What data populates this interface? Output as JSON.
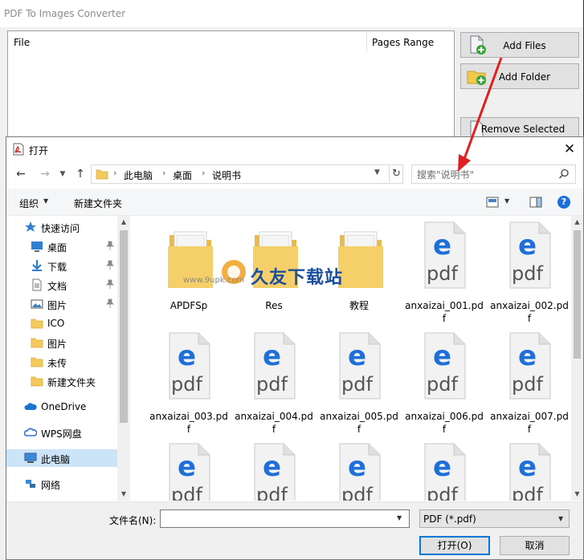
{
  "app": {
    "title": "PDF To Images Converter",
    "columns": {
      "file": "File",
      "pages_range": "Pages Range"
    },
    "buttons": {
      "add_files": "Add Files",
      "add_folder": "Add Folder",
      "remove_selected": "Remove Selected"
    }
  },
  "dialog": {
    "title": "打开",
    "address": {
      "crumbs": [
        "此电脑",
        "桌面",
        "说明书"
      ]
    },
    "search": {
      "placeholder": "搜索\"说明书\""
    },
    "toolbar": {
      "organize": "组织",
      "new_folder": "新建文件夹"
    },
    "nav": [
      {
        "label": "快速访问",
        "icon": "star-icon",
        "pinned": false
      },
      {
        "label": "桌面",
        "icon": "desktop-icon",
        "pinned": true
      },
      {
        "label": "下载",
        "icon": "download-icon",
        "pinned": true
      },
      {
        "label": "文档",
        "icon": "document-icon",
        "pinned": true
      },
      {
        "label": "图片",
        "icon": "picture-icon",
        "pinned": true
      },
      {
        "label": "ICO",
        "icon": "folder-icon",
        "pinned": false
      },
      {
        "label": "图片",
        "icon": "folder-icon",
        "pinned": false
      },
      {
        "label": "未传",
        "icon": "folder-icon",
        "pinned": false
      },
      {
        "label": "新建文件夹",
        "icon": "folder-icon",
        "pinned": false
      },
      {
        "label": "OneDrive",
        "icon": "cloud-icon",
        "pinned": false
      },
      {
        "label": "WPS网盘",
        "icon": "wps-cloud-icon",
        "pinned": false
      },
      {
        "label": "此电脑",
        "icon": "computer-icon",
        "pinned": false,
        "selected": true
      },
      {
        "label": "网络",
        "icon": "network-icon",
        "pinned": false
      }
    ],
    "files": [
      {
        "name": "APDFSp",
        "type": "folder"
      },
      {
        "name": "Res",
        "type": "folder"
      },
      {
        "name": "教程",
        "type": "folder"
      },
      {
        "name": "anxaizai_001.pdf",
        "type": "pdf"
      },
      {
        "name": "anxaizai_002.pdf",
        "type": "pdf"
      },
      {
        "name": "anxaizai_003.pdf",
        "type": "pdf"
      },
      {
        "name": "anxaizai_004.pdf",
        "type": "pdf"
      },
      {
        "name": "anxaizai_005.pdf",
        "type": "pdf"
      },
      {
        "name": "anxaizai_006.pdf",
        "type": "pdf"
      },
      {
        "name": "anxaizai_007.pdf",
        "type": "pdf"
      },
      {
        "name": "",
        "type": "pdf"
      },
      {
        "name": "",
        "type": "pdf"
      },
      {
        "name": "",
        "type": "pdf"
      },
      {
        "name": "",
        "type": "pdf"
      },
      {
        "name": "",
        "type": "pdf"
      }
    ],
    "pdf_icon_text": "pdf",
    "filename": {
      "label": "文件名(N):",
      "value": ""
    },
    "filetype": {
      "value": "PDF (*.pdf)"
    },
    "buttons": {
      "open": "打开(O)",
      "cancel": "取消"
    }
  },
  "watermark": {
    "text": "久友下载站",
    "url": "www.9upk.com"
  },
  "colors": {
    "accent": "#0078d7",
    "edge_blue": "#1e6fd9",
    "folder": "#f4c95d",
    "arrow": "#e02020"
  }
}
